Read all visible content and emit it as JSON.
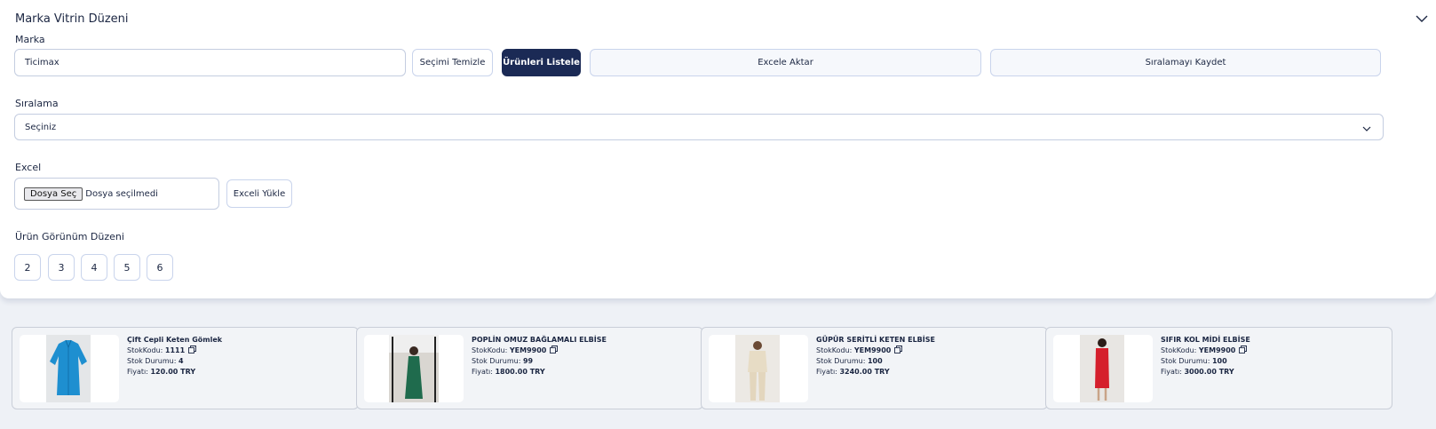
{
  "panel": {
    "title": "Marka Vitrin Düzeni"
  },
  "brand": {
    "label": "Marka",
    "value": "Ticimax"
  },
  "buttons": {
    "clear": "Seçimi Temizle",
    "list": "Ürünleri Listele",
    "export": "Excele Aktar",
    "save_order": "Sıralamayı Kaydet",
    "upload_excel": "Exceli Yükle"
  },
  "sorting": {
    "label": "Sıralama",
    "selected": "Seçiniz"
  },
  "excel": {
    "label": "Excel",
    "file_button": "Dosya Seç",
    "file_status": "Dosya seçilmedi"
  },
  "layout": {
    "label": "Ürün Görünüm Düzeni",
    "options": [
      "2",
      "3",
      "4",
      "5",
      "6"
    ]
  },
  "product_labels": {
    "stock_code": "StokKodu:",
    "stock_status": "Stok Durumu:",
    "price": "Fiyatı:"
  },
  "products": [
    {
      "name": "Çift Cepli Keten Gömlek",
      "stock_code": "1111",
      "stock_status": "4",
      "price": "120.00 TRY",
      "image": "blue-shirt"
    },
    {
      "name": "POPLİN OMUZ BAĞLAMALI ELBİSE",
      "stock_code": "YEM9900",
      "stock_status": "99",
      "price": "1800.00 TRY",
      "image": "green-dress"
    },
    {
      "name": "GÜPÜR SERİTLİ KETEN ELBİSE",
      "stock_code": "YEM9900",
      "stock_status": "100",
      "price": "3240.00 TRY",
      "image": "beige-outfit"
    },
    {
      "name": "SIFIR KOL MİDİ ELBİSE",
      "stock_code": "YEM9900",
      "stock_status": "100",
      "price": "3000.00 TRY",
      "image": "red-dress"
    }
  ],
  "colors": {
    "primary": "#1b2a55",
    "border": "#c9d4ec",
    "card_bg": "#f2f4f7",
    "page_bg": "#eef1f6"
  }
}
